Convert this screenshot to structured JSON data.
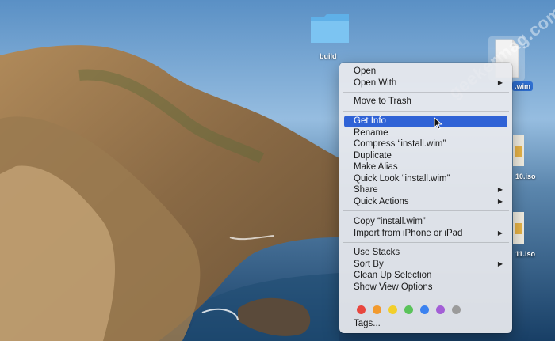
{
  "desktop": {
    "icons": [
      {
        "label": "build"
      },
      {
        "label": ".wim"
      },
      {
        "label": "10.iso"
      },
      {
        "label": "11.iso"
      }
    ]
  },
  "watermark": "geekermag.com",
  "context_menu": {
    "groups": [
      [
        {
          "label": "Open"
        },
        {
          "label": "Open With",
          "submenu": true
        }
      ],
      [
        {
          "label": "Move to Trash"
        }
      ],
      [
        {
          "label": "Get Info",
          "highlighted": true
        },
        {
          "label": "Rename"
        },
        {
          "label": "Compress “install.wim”"
        },
        {
          "label": "Duplicate"
        },
        {
          "label": "Make Alias"
        },
        {
          "label": "Quick Look “install.wim”"
        },
        {
          "label": "Share",
          "submenu": true
        },
        {
          "label": "Quick Actions",
          "submenu": true
        }
      ],
      [
        {
          "label": "Copy “install.wim”"
        },
        {
          "label": "Import from iPhone or iPad",
          "submenu": true
        }
      ],
      [
        {
          "label": "Use Stacks"
        },
        {
          "label": "Sort By",
          "submenu": true
        },
        {
          "label": "Clean Up Selection"
        },
        {
          "label": "Show View Options"
        }
      ]
    ],
    "tag_colors": [
      "#e8473f",
      "#f29a2e",
      "#f2cf2b",
      "#5ac35a",
      "#3b82f0",
      "#a35fd6",
      "#9b9b9b"
    ],
    "tags_label": "Tags..."
  }
}
